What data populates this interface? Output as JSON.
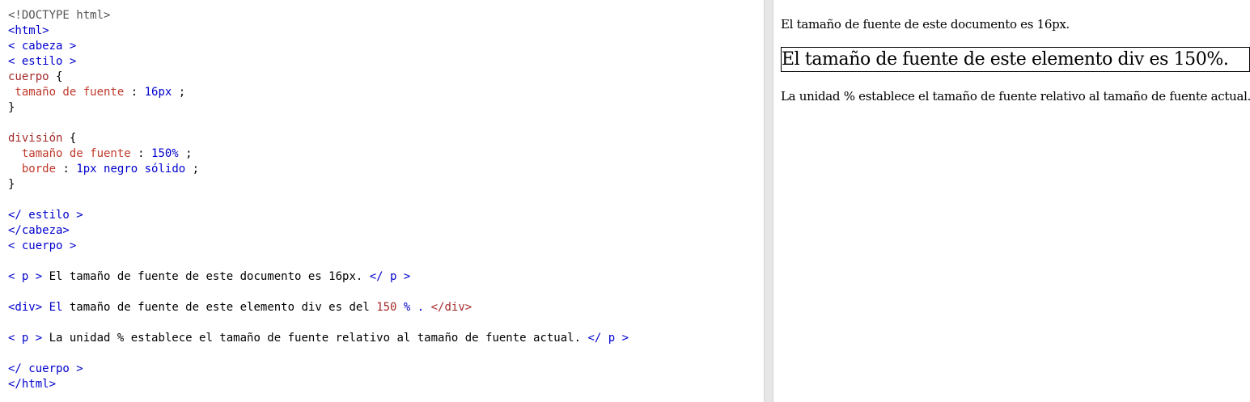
{
  "editor": {
    "lines": [
      [
        {
          "t": "<!DOCTYPE html>",
          "c": "doctype"
        }
      ],
      [
        {
          "t": "<html>",
          "c": "tag"
        }
      ],
      [
        {
          "t": "< cabeza >",
          "c": "tag"
        }
      ],
      [
        {
          "t": "< estilo >",
          "c": "tag"
        }
      ],
      [
        {
          "t": "cuerpo",
          "c": "selector"
        },
        {
          "t": " {",
          "c": "plain"
        }
      ],
      [
        {
          "t": " tamaño de fuente",
          "c": "prop"
        },
        {
          "t": " : ",
          "c": "plain"
        },
        {
          "t": "16px",
          "c": "value"
        },
        {
          "t": " ;",
          "c": "plain"
        }
      ],
      [
        {
          "t": "}",
          "c": "plain"
        }
      ],
      [
        {
          "t": "",
          "c": "plain"
        }
      ],
      [
        {
          "t": "división",
          "c": "selector"
        },
        {
          "t": " {",
          "c": "plain"
        }
      ],
      [
        {
          "t": "  tamaño de fuente",
          "c": "prop"
        },
        {
          "t": " : ",
          "c": "plain"
        },
        {
          "t": "150%",
          "c": "value"
        },
        {
          "t": " ;",
          "c": "plain"
        }
      ],
      [
        {
          "t": "  borde",
          "c": "prop"
        },
        {
          "t": " : ",
          "c": "plain"
        },
        {
          "t": "1px negro sólido",
          "c": "value"
        },
        {
          "t": " ;",
          "c": "plain"
        }
      ],
      [
        {
          "t": "}",
          "c": "plain"
        }
      ],
      [
        {
          "t": "",
          "c": "plain"
        }
      ],
      [
        {
          "t": "</ estilo >",
          "c": "tag"
        }
      ],
      [
        {
          "t": "</cabeza>",
          "c": "tag"
        }
      ],
      [
        {
          "t": "< cuerpo >",
          "c": "tag"
        }
      ],
      [
        {
          "t": "",
          "c": "plain"
        }
      ],
      [
        {
          "t": "< p >",
          "c": "tag"
        },
        {
          "t": " El tamaño de fuente de este documento es 16px. ",
          "c": "plain"
        },
        {
          "t": "</ p >",
          "c": "tag"
        }
      ],
      [
        {
          "t": "",
          "c": "plain"
        }
      ],
      [
        {
          "t": "<div>",
          "c": "tag"
        },
        {
          "t": " El",
          "c": "tag"
        },
        {
          "t": " tamaño de fuente de este elemento div es del ",
          "c": "plain"
        },
        {
          "t": "150",
          "c": "num"
        },
        {
          "t": " % .",
          "c": "tag"
        },
        {
          "t": " </div>",
          "c": "num"
        }
      ],
      [
        {
          "t": "",
          "c": "plain"
        }
      ],
      [
        {
          "t": "< p >",
          "c": "tag"
        },
        {
          "t": " La unidad % establece el tamaño de fuente relativo al tamaño de fuente actual. ",
          "c": "plain"
        },
        {
          "t": "</ p >",
          "c": "tag"
        }
      ],
      [
        {
          "t": "",
          "c": "plain"
        }
      ],
      [
        {
          "t": "</ cuerpo >",
          "c": "tag"
        }
      ],
      [
        {
          "t": "</html>",
          "c": "tag"
        }
      ]
    ]
  },
  "preview": {
    "p1": "El tamaño de fuente de este documento es 16px.",
    "div_text": "El tamaño de fuente de este elemento div es 150%.",
    "p2": "La unidad % establece el tamaño de fuente relativo al tamaño de fuente actual."
  },
  "colors": {
    "accent": "#4caf7a",
    "tag": "#0000cd",
    "selector": "#a52a2a",
    "property": "#c0392b"
  }
}
